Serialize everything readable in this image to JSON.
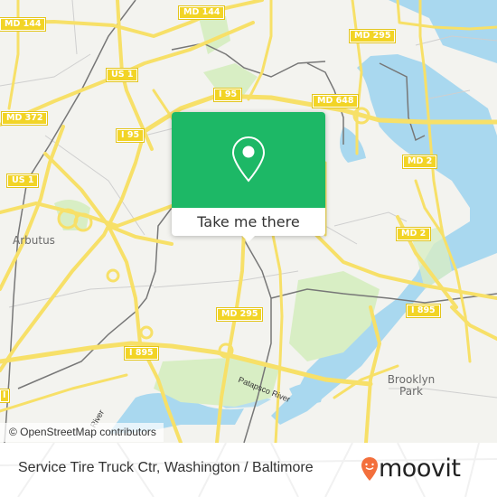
{
  "map": {
    "highway_shields": [
      {
        "id": "md144-west",
        "label": "MD 144"
      },
      {
        "id": "md144-north",
        "label": "MD 144"
      },
      {
        "id": "md295-north",
        "label": "MD 295"
      },
      {
        "id": "us1-north",
        "label": "US 1"
      },
      {
        "id": "i95-north",
        "label": "I 95"
      },
      {
        "id": "md648",
        "label": "MD 648"
      },
      {
        "id": "md372",
        "label": "MD 372"
      },
      {
        "id": "i95-west",
        "label": "I 95"
      },
      {
        "id": "us1-west",
        "label": "US 1"
      },
      {
        "id": "md2-north",
        "label": "MD 2"
      },
      {
        "id": "md2-south",
        "label": "MD 2"
      },
      {
        "id": "md295-south",
        "label": "MD 295"
      },
      {
        "id": "i895-east",
        "label": "I 895"
      },
      {
        "id": "i895-west",
        "label": "I 895"
      },
      {
        "id": "i1-left",
        "label": "I"
      }
    ],
    "places": [
      {
        "id": "arbutus",
        "label": "Arbutus"
      },
      {
        "id": "brooklyn-park",
        "label": "Brooklyn Park"
      }
    ],
    "water_labels": [
      {
        "id": "patapsco-river",
        "label": "Patapsco River"
      },
      {
        "id": "river-fragment",
        "label": "River"
      }
    ],
    "attribution": "© OpenStreetMap contributors",
    "colors": {
      "land": "#f3f3ef",
      "water": "#a9d8ef",
      "park": "#d8eec4",
      "road_major": "#f7e068",
      "shield": "#f2d426",
      "railway": "#777777"
    }
  },
  "popup": {
    "cta_label": "Take me there",
    "icon": "location-pin-icon",
    "accent_color": "#1db866"
  },
  "footer": {
    "title": "Service Tire Truck Ctr, Washington / Baltimore",
    "brand": "moovit",
    "brand_color": "#f36f3c"
  }
}
